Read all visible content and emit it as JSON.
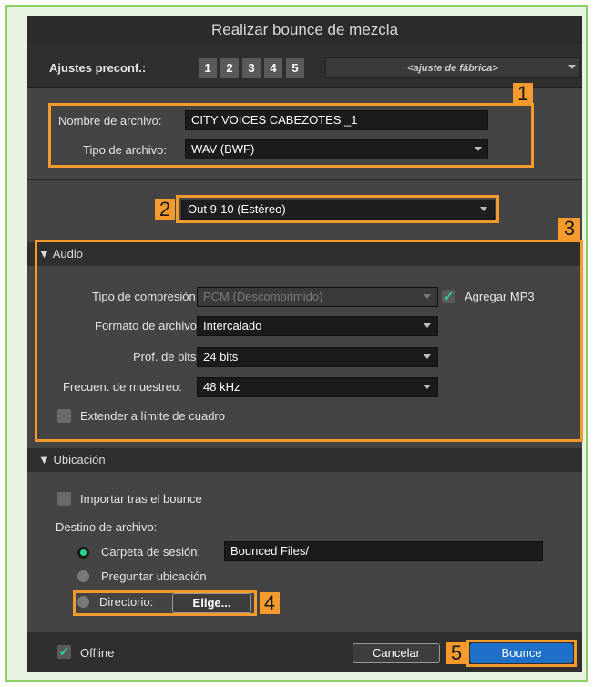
{
  "window": {
    "title": "Realizar bounce de mezcla"
  },
  "presets": {
    "label": "Ajustes preconf.:",
    "buttons": [
      "1",
      "2",
      "3",
      "4",
      "5"
    ],
    "factory": "<ajuste de fábrica>"
  },
  "file": {
    "name_label": "Nombre de archivo:",
    "name_value": "CITY VOICES CABEZOTES _1",
    "type_label": "Tipo de archivo:",
    "type_value": "WAV (BWF)"
  },
  "output": {
    "value": "Out 9-10 (Estéreo)"
  },
  "audio": {
    "header": "▼ Audio",
    "compression_label": "Tipo de compresión:",
    "compression_value": "PCM (Descomprimido)",
    "mp3_label": "Agregar MP3",
    "format_label": "Formato de archivo:",
    "format_value": "Intercalado",
    "bits_label": "Prof. de bits:",
    "bits_value": "24 bits",
    "rate_label": "Frecuen. de muestreo:",
    "rate_value": "48 kHz",
    "extend_label": "Extender a límite de cuadro"
  },
  "location": {
    "header": "▼ Ubicación",
    "import_label": "Importar tras el bounce",
    "dest_label": "Destino de archivo:",
    "session_folder_label": "Carpeta de sesión:",
    "session_folder_value": "Bounced Files/",
    "ask_label": "Preguntar ubicación",
    "directory_label": "Directorio:",
    "choose_label": "Elige..."
  },
  "footer": {
    "offline_label": "Offline",
    "cancel_label": "Cancelar",
    "bounce_label": "Bounce"
  },
  "callouts": [
    "1",
    "2",
    "3",
    "4",
    "5"
  ],
  "colors": {
    "highlight": "#f59a2c",
    "accent_green": "#2ed38a",
    "primary_blue": "#1e6fc8"
  }
}
